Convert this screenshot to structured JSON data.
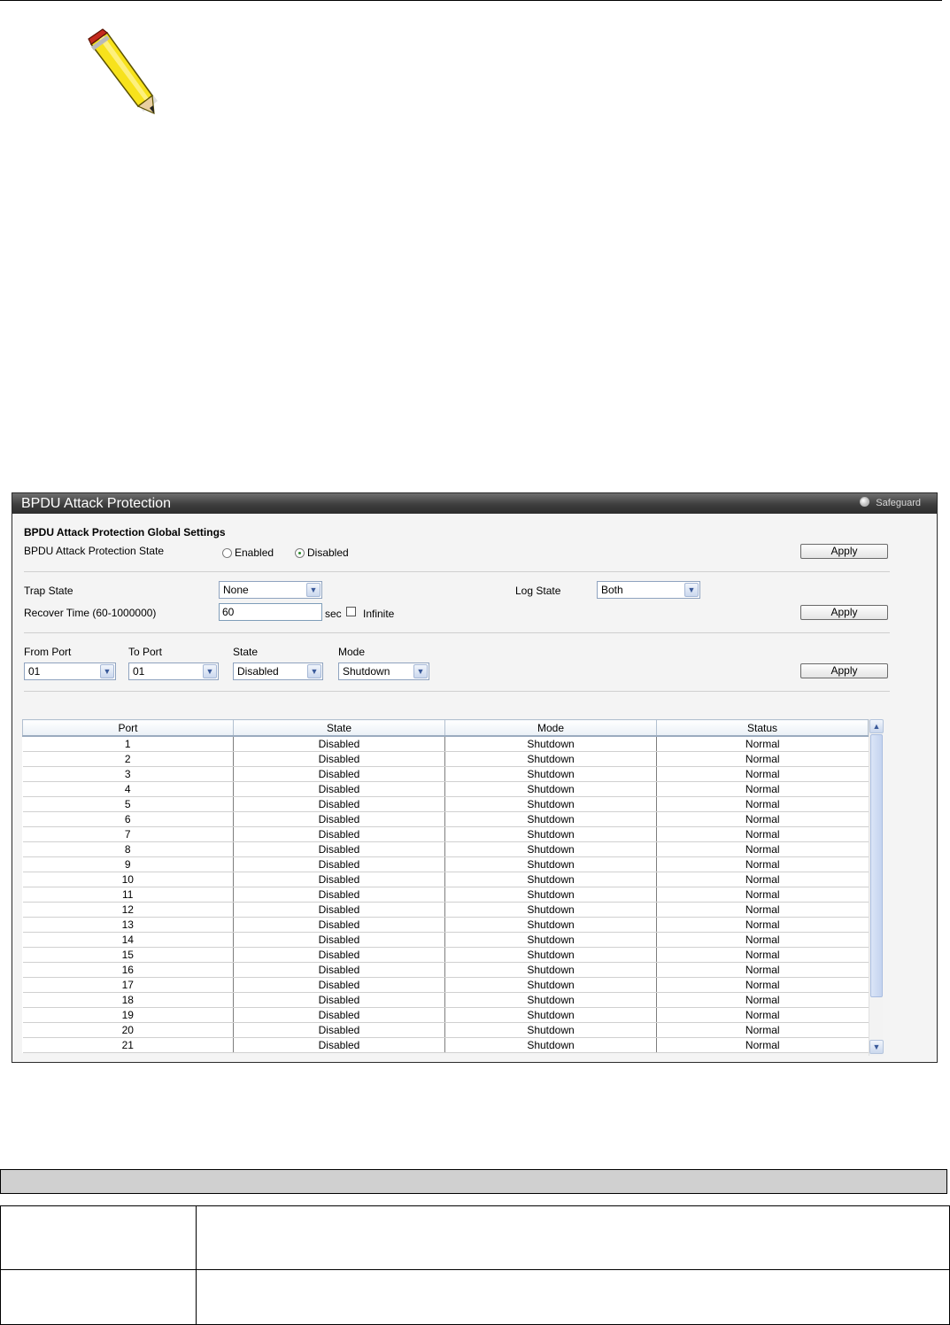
{
  "note_icon": "pencil-icon",
  "window": {
    "title": "BPDU Attack Protection",
    "safeguard_label": "Safeguard"
  },
  "global": {
    "section_title": "BPDU Attack Protection Global Settings",
    "state_label": "BPDU Attack Protection State",
    "enabled_label": "Enabled",
    "disabled_label": "Disabled",
    "selected": "Disabled",
    "apply_label": "Apply"
  },
  "trap": {
    "trap_label": "Trap State",
    "trap_value": "None",
    "log_label": "Log State",
    "log_value": "Both",
    "recover_label": "Recover Time (60-1000000)",
    "recover_value": "60",
    "sec_label": "sec",
    "infinite_label": "Infinite",
    "infinite_checked": false,
    "apply_label": "Apply"
  },
  "port_settings": {
    "from_label": "From Port",
    "from_value": "01",
    "to_label": "To Port",
    "to_value": "01",
    "state_label": "State",
    "state_value": "Disabled",
    "mode_label": "Mode",
    "mode_value": "Shutdown",
    "apply_label": "Apply"
  },
  "table": {
    "columns": [
      "Port",
      "State",
      "Mode",
      "Status"
    ],
    "rows": [
      [
        "1",
        "Disabled",
        "Shutdown",
        "Normal"
      ],
      [
        "2",
        "Disabled",
        "Shutdown",
        "Normal"
      ],
      [
        "3",
        "Disabled",
        "Shutdown",
        "Normal"
      ],
      [
        "4",
        "Disabled",
        "Shutdown",
        "Normal"
      ],
      [
        "5",
        "Disabled",
        "Shutdown",
        "Normal"
      ],
      [
        "6",
        "Disabled",
        "Shutdown",
        "Normal"
      ],
      [
        "7",
        "Disabled",
        "Shutdown",
        "Normal"
      ],
      [
        "8",
        "Disabled",
        "Shutdown",
        "Normal"
      ],
      [
        "9",
        "Disabled",
        "Shutdown",
        "Normal"
      ],
      [
        "10",
        "Disabled",
        "Shutdown",
        "Normal"
      ],
      [
        "11",
        "Disabled",
        "Shutdown",
        "Normal"
      ],
      [
        "12",
        "Disabled",
        "Shutdown",
        "Normal"
      ],
      [
        "13",
        "Disabled",
        "Shutdown",
        "Normal"
      ],
      [
        "14",
        "Disabled",
        "Shutdown",
        "Normal"
      ],
      [
        "15",
        "Disabled",
        "Shutdown",
        "Normal"
      ],
      [
        "16",
        "Disabled",
        "Shutdown",
        "Normal"
      ],
      [
        "17",
        "Disabled",
        "Shutdown",
        "Normal"
      ],
      [
        "18",
        "Disabled",
        "Shutdown",
        "Normal"
      ],
      [
        "19",
        "Disabled",
        "Shutdown",
        "Normal"
      ],
      [
        "20",
        "Disabled",
        "Shutdown",
        "Normal"
      ],
      [
        "21",
        "Disabled",
        "Shutdown",
        "Normal"
      ]
    ]
  }
}
